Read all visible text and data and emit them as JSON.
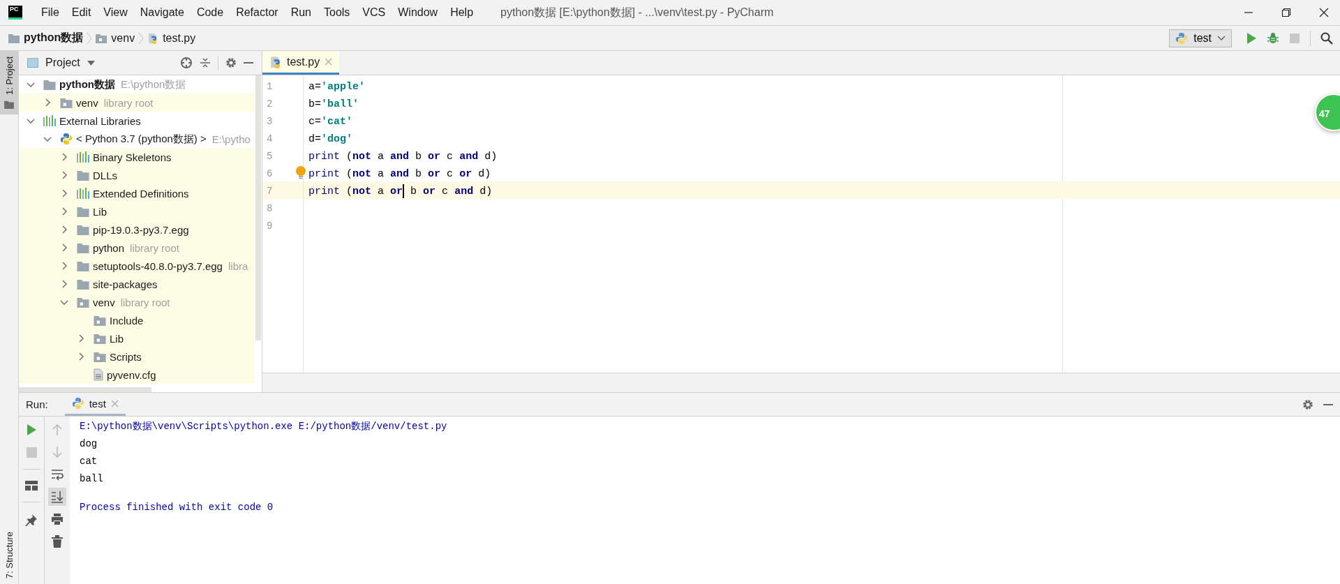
{
  "window": {
    "logo": "PC",
    "title": "python数据 [E:\\python数据] - ...\\venv\\test.py - PyCharm"
  },
  "menu": [
    "File",
    "Edit",
    "View",
    "Navigate",
    "Code",
    "Refactor",
    "Run",
    "Tools",
    "VCS",
    "Window",
    "Help"
  ],
  "breadcrumbs": [
    {
      "label": "python数据",
      "kind": "project"
    },
    {
      "label": "venv",
      "kind": "libfolder"
    },
    {
      "label": "test.py",
      "kind": "python"
    }
  ],
  "run_config": {
    "label": "test"
  },
  "toolbar": [
    {
      "kind": "run",
      "disabled": false
    },
    {
      "kind": "debug",
      "disabled": false
    },
    {
      "kind": "stop",
      "disabled": true
    },
    {
      "kind": "search",
      "disabled": false
    }
  ],
  "side_tabs": [
    {
      "label": "1: Project",
      "selected": true
    },
    {
      "label": "7: Structure",
      "selected": false
    }
  ],
  "project_panel": {
    "title": "Project",
    "tree": [
      {
        "name": "python数据",
        "hint": "E:\\python数据",
        "kind": "project",
        "library": false,
        "expanded": true,
        "children": [
          {
            "name": "venv",
            "hint": "library root",
            "kind": "libfolder",
            "library": true,
            "expanded": false
          }
        ]
      },
      {
        "name": "External Libraries",
        "kind": "libs",
        "library": false,
        "expanded": true,
        "children": [
          {
            "name": "< Python 3.7 (python数据) >",
            "hint": "E:\\pytho",
            "kind": "python",
            "library": false,
            "expanded": true,
            "children": [
              {
                "name": "Binary Skeletons",
                "kind": "libs",
                "library": true,
                "expanded": false
              },
              {
                "name": "DLLs",
                "kind": "folder",
                "library": true,
                "expanded": false
              },
              {
                "name": "Extended Definitions",
                "kind": "libs",
                "library": true,
                "expanded": false
              },
              {
                "name": "Lib",
                "kind": "folder",
                "library": true,
                "expanded": false
              },
              {
                "name": "pip-19.0.3-py3.7.egg",
                "kind": "folder",
                "library": true,
                "expanded": false
              },
              {
                "name": "python",
                "hint": "library root",
                "kind": "folder",
                "library": true,
                "expanded": false
              },
              {
                "name": "setuptools-40.8.0-py3.7.egg",
                "hint": "libra",
                "kind": "folder",
                "library": true,
                "expanded": false
              },
              {
                "name": "site-packages",
                "kind": "folder",
                "library": true,
                "expanded": false
              },
              {
                "name": "venv",
                "hint": "library root",
                "kind": "libfolder",
                "library": true,
                "expanded": true,
                "children": [
                  {
                    "name": "Include",
                    "kind": "libfolder",
                    "library": true
                  },
                  {
                    "name": "Lib",
                    "kind": "libfolder",
                    "library": true,
                    "expanded": false
                  },
                  {
                    "name": "Scripts",
                    "kind": "libfolder",
                    "library": true,
                    "expanded": false
                  },
                  {
                    "name": "pyvenv.cfg",
                    "kind": "file",
                    "library": true
                  }
                ]
              }
            ]
          }
        ]
      }
    ]
  },
  "editor": {
    "tabs": [
      {
        "label": "test.py",
        "selected": true
      }
    ],
    "badge": "47",
    "lines": [
      {
        "number": "1",
        "current": false,
        "tokens": [
          {
            "text": "a=",
            "kind": "plain"
          },
          {
            "text": "'apple'",
            "kind": "string"
          }
        ]
      },
      {
        "number": "2",
        "current": false,
        "tokens": [
          {
            "text": "b=",
            "kind": "plain"
          },
          {
            "text": "'ball'",
            "kind": "string"
          }
        ]
      },
      {
        "number": "3",
        "current": false,
        "tokens": [
          {
            "text": "c=",
            "kind": "plain"
          },
          {
            "text": "'cat'",
            "kind": "string"
          }
        ]
      },
      {
        "number": "4",
        "current": false,
        "tokens": [
          {
            "text": "d=",
            "kind": "plain"
          },
          {
            "text": "'dog'",
            "kind": "string"
          }
        ]
      },
      {
        "number": "5",
        "current": false,
        "tokens": [
          {
            "text": "print",
            "kind": "builtin"
          },
          {
            "text": " (",
            "kind": "plain"
          },
          {
            "text": "not",
            "kind": "keyword"
          },
          {
            "text": " a ",
            "kind": "plain"
          },
          {
            "text": "and",
            "kind": "keyword"
          },
          {
            "text": " b ",
            "kind": "plain"
          },
          {
            "text": "or",
            "kind": "keyword"
          },
          {
            "text": " c ",
            "kind": "plain"
          },
          {
            "text": "and",
            "kind": "keyword"
          },
          {
            "text": " d)",
            "kind": "plain"
          }
        ]
      },
      {
        "number": "6",
        "current": false,
        "bulb": true,
        "tokens": [
          {
            "text": "print",
            "kind": "builtin"
          },
          {
            "text": " (",
            "kind": "plain"
          },
          {
            "text": "not",
            "kind": "keyword"
          },
          {
            "text": " a ",
            "kind": "plain"
          },
          {
            "text": "and",
            "kind": "keyword"
          },
          {
            "text": " b ",
            "kind": "plain"
          },
          {
            "text": "or",
            "kind": "keyword"
          },
          {
            "text": " c ",
            "kind": "plain"
          },
          {
            "text": "or",
            "kind": "keyword"
          },
          {
            "text": " d)",
            "kind": "plain"
          }
        ]
      },
      {
        "number": "7",
        "current": true,
        "tokens": [
          {
            "text": "print",
            "kind": "builtin"
          },
          {
            "text": " (",
            "kind": "plain"
          },
          {
            "text": "not",
            "kind": "keyword"
          },
          {
            "text": " a ",
            "kind": "plain"
          },
          {
            "text": "or",
            "kind": "keyword",
            "caret": true
          },
          {
            "text": " b ",
            "kind": "plain"
          },
          {
            "text": "or",
            "kind": "keyword"
          },
          {
            "text": " c ",
            "kind": "plain"
          },
          {
            "text": "and",
            "kind": "keyword"
          },
          {
            "text": " d)",
            "kind": "plain"
          }
        ]
      },
      {
        "number": "8",
        "current": false
      },
      {
        "number": "9",
        "current": false
      }
    ]
  },
  "run_panel": {
    "title": "Run:",
    "tabs": [
      {
        "label": "test",
        "selected": true
      }
    ],
    "tools": [
      {
        "kind": "run",
        "disabled": false
      },
      {
        "kind": "stop",
        "disabled": true
      },
      {
        "kind": "layout",
        "disabled": false
      },
      {
        "kind": "pin",
        "disabled": false
      }
    ],
    "tools2": [
      {
        "kind": "up",
        "disabled": true,
        "on": false
      },
      {
        "kind": "down",
        "disabled": true,
        "on": false
      },
      {
        "kind": "wrap",
        "disabled": false,
        "on": false
      },
      {
        "kind": "scroll-end",
        "disabled": false,
        "on": true
      },
      {
        "kind": "print",
        "disabled": false,
        "on": false
      },
      {
        "kind": "trash",
        "disabled": false,
        "on": false
      }
    ],
    "console": [
      {
        "text": "E:\\python数据\\venv\\Scripts\\python.exe E:/python数据/venv/test.py",
        "kind": "command"
      },
      {
        "text": "dog",
        "kind": "output"
      },
      {
        "text": "cat",
        "kind": "output"
      },
      {
        "text": "ball",
        "kind": "output"
      },
      {
        "text": "Process finished with exit code 0",
        "kind": "exit"
      }
    ]
  }
}
